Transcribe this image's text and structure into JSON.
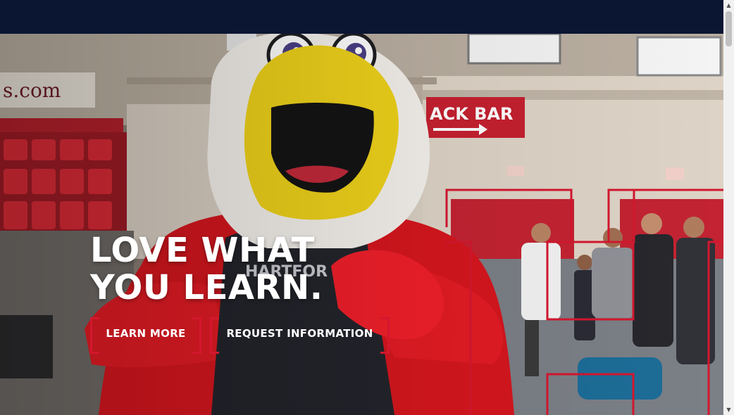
{
  "hero": {
    "headline_line1": "LOVE WHAT",
    "headline_line2": "YOU LEARN.",
    "background": "Red hawk mascot in a gymnasium with spectators",
    "accent_color": "#d4172e",
    "background_signs": {
      "left_sign": "s.com",
      "snack_bar": "ACK BAR"
    }
  },
  "buttons": {
    "learn_more": "LEARN MORE",
    "request_information": "REQUEST INFORMATION"
  },
  "header": {
    "color": "#0b1633"
  },
  "scrollbar": {
    "up_icon": "triangle-up",
    "down_icon": "triangle-down"
  }
}
